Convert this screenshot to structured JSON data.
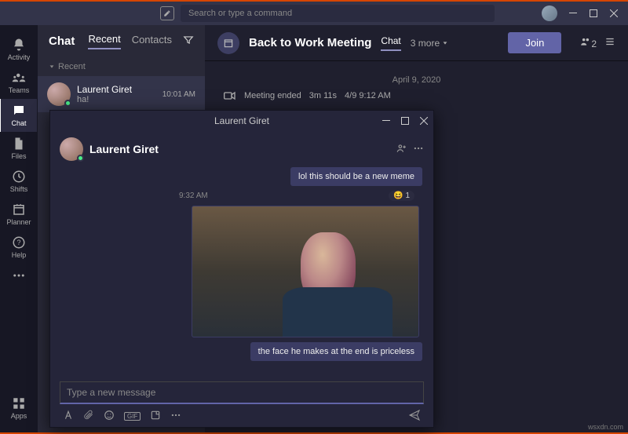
{
  "titlebar": {
    "search_placeholder": "Search or type a command"
  },
  "rail": {
    "activity": "Activity",
    "teams": "Teams",
    "chat": "Chat",
    "files": "Files",
    "shifts": "Shifts",
    "planner": "Planner",
    "help": "Help",
    "apps": "Apps"
  },
  "chatlist": {
    "title": "Chat",
    "tab_recent": "Recent",
    "tab_contacts": "Contacts",
    "section_recent": "Recent",
    "items": [
      {
        "name": "Laurent Giret",
        "preview": "ha!",
        "time": "10:01 AM"
      }
    ]
  },
  "conversation": {
    "title": "Back to Work Meeting",
    "tab_chat": "Chat",
    "more_label": "3 more",
    "join_label": "Join",
    "participant_badge": "2",
    "date_label": "April 9, 2020",
    "meeting_ended": "Meeting ended",
    "meeting_duration": "3m 11s",
    "meeting_time": "4/9 9:12 AM"
  },
  "popout": {
    "window_title": "Laurent Giret",
    "header_name": "Laurent Giret",
    "msg_prev": "lol this should be a new meme",
    "msg_time": "9:32 AM",
    "reaction_count": "1",
    "msg_caption": "the face he makes at the end is priceless",
    "compose_placeholder": "Type a new message",
    "gif_label": "GIF"
  },
  "watermark": "wsxdn.com"
}
